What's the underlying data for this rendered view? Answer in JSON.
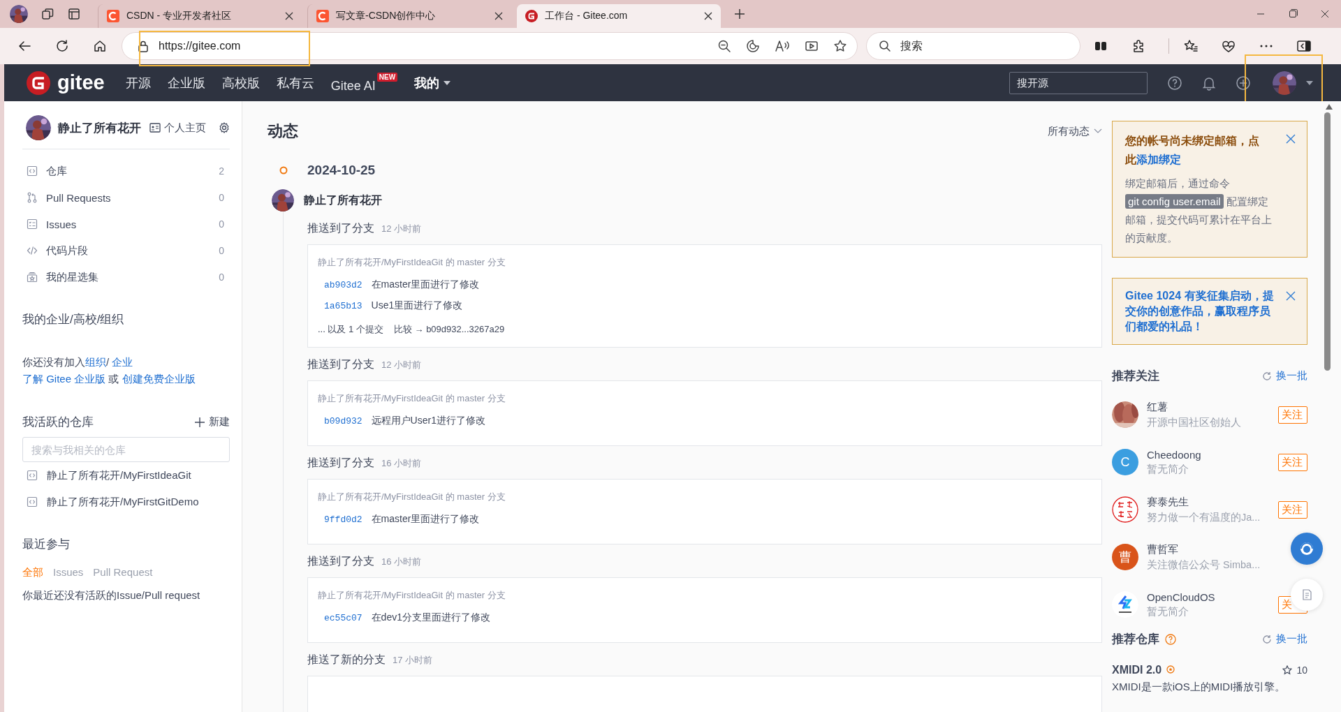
{
  "browser": {
    "tabs": [
      {
        "title": "CSDN - 专业开发者社区",
        "selected": false
      },
      {
        "title": "写文章-CSDN创作中心",
        "selected": false
      },
      {
        "title": "工作台 - Gitee.com",
        "selected": true
      }
    ],
    "address": "https://gitee.com",
    "search_placeholder": "搜索"
  },
  "nav": {
    "logo": "gitee",
    "items": [
      {
        "label": "开源",
        "kind": "link"
      },
      {
        "label": "企业版",
        "kind": "link"
      },
      {
        "label": "高校版",
        "kind": "link"
      },
      {
        "label": "私有云",
        "kind": "link"
      },
      {
        "label": "Gitee AI",
        "kind": "badged",
        "badge": "NEW"
      },
      {
        "label": "我的",
        "kind": "dropdown"
      }
    ],
    "search_placeholder": "搜开源"
  },
  "sidebar": {
    "user": "静止了所有花开",
    "profile_link": "个人主页",
    "items": [
      {
        "label": "仓库",
        "count": "2"
      },
      {
        "label": "Pull Requests",
        "count": "0"
      },
      {
        "label": "Issues",
        "count": "0"
      },
      {
        "label": "代码片段",
        "count": "0"
      },
      {
        "label": "我的星选集",
        "count": "0"
      }
    ],
    "org_title": "我的企业/高校/组织",
    "org_lines": [
      [
        {
          "text": "你还没有加入",
          "link": false
        },
        {
          "text": "组织",
          "link": true
        },
        {
          "text": "/ ",
          "link": false
        },
        {
          "text": "企业",
          "link": true
        }
      ],
      [
        {
          "text": "了解 Gitee 企业版",
          "link": true
        },
        {
          "text": " 或 ",
          "link": false
        },
        {
          "text": "创建免费企业版",
          "link": true
        }
      ]
    ],
    "repos_title": "我活跃的仓库",
    "new_label": "新建",
    "repo_search_placeholder": "搜索与我相关的仓库",
    "repos": [
      "静止了所有花开/MyFirstIdeaGit",
      "静止了所有花开/MyFirstGitDemo"
    ],
    "recent_title": "最近参与",
    "recent_tabs": [
      {
        "label": "全部",
        "selected": true
      },
      {
        "label": "Issues",
        "selected": false
      },
      {
        "label": "Pull Request",
        "selected": false
      }
    ],
    "recent_empty": "你最近还没有活跃的Issue/Pull request"
  },
  "feed": {
    "title": "动态",
    "filter": "所有动态",
    "date": "2024-10-25",
    "user": "静止了所有花开",
    "events": [
      {
        "action": "推送到了分支",
        "time": "12 小时前",
        "repo_line": "静止了所有花开/MyFirstIdeaGit 的 master 分支",
        "commits": [
          {
            "sha": "ab903d2",
            "message": "在master里面进行了修改"
          },
          {
            "sha": "1a65b13",
            "message": "Use1里面进行了修改"
          }
        ],
        "more": "... 以及 1 个提交",
        "compare": "比较 → b09d932...3267a29"
      },
      {
        "action": "推送到了分支",
        "time": "12 小时前",
        "repo_line": "静止了所有花开/MyFirstIdeaGit 的 master 分支",
        "commits": [
          {
            "sha": "b09d932",
            "message": "远程用户User1进行了修改"
          }
        ]
      },
      {
        "action": "推送到了分支",
        "time": "16 小时前",
        "repo_line": "静止了所有花开/MyFirstIdeaGit 的 master 分支",
        "commits": [
          {
            "sha": "9ffd0d2",
            "message": "在master里面进行了修改"
          }
        ]
      },
      {
        "action": "推送到了分支",
        "time": "16 小时前",
        "repo_line": "静止了所有花开/MyFirstIdeaGit 的 master 分支",
        "commits": [
          {
            "sha": "ec55c07",
            "message": "在dev1分支里面进行了修改"
          }
        ]
      },
      {
        "action": "推送了新的分支",
        "time": "17 小时前"
      }
    ]
  },
  "aside": {
    "notices": [
      {
        "title": [
          {
            "text": "您的帐号尚未绑定邮箱，点此",
            "link": false
          },
          {
            "text": "添加绑定",
            "link": true
          }
        ],
        "body": [
          {
            "text": "绑定邮箱后，通过命令 ",
            "code": false
          },
          {
            "text": "git config user.email",
            "code": true
          },
          {
            "text": " 配置绑定邮箱，提交代码可累计在平台上的贡献度。",
            "code": false
          }
        ]
      },
      {
        "title": [
          {
            "text": "Gitee 1024 有奖征集启动，提交你的创意作品，赢取程序员们都爱的礼品！",
            "link": true
          }
        ]
      }
    ],
    "follow_title": "推荐关注",
    "refresh": "换一批",
    "users": [
      {
        "name": "红薯",
        "bio": "开源中国社区创始人",
        "button": "关注"
      },
      {
        "name": "Cheedoong",
        "bio": "暂无简介",
        "kind": "letter",
        "letter": "C",
        "color": "#3b9ee0",
        "button": "关注"
      },
      {
        "name": "赛泰先生",
        "bio": "努力做一个有温度的Ja...",
        "kind": "seal",
        "button": "关注"
      },
      {
        "name": "曹哲军",
        "bio": "关注微信公众号 Simba...",
        "kind": "letter",
        "letter": "曹",
        "color": "#d9541a"
      },
      {
        "name": "OpenCloudOS",
        "bio": "暂无简介",
        "kind": "logo",
        "button": "关"
      }
    ],
    "repos_title": "推荐仓库",
    "repos_refresh": "换一批",
    "repos": [
      {
        "name": "XMIDI 2.0",
        "stars": "10",
        "desc": "XMIDI是一款iOS上的MIDI播放引擎。"
      }
    ]
  }
}
